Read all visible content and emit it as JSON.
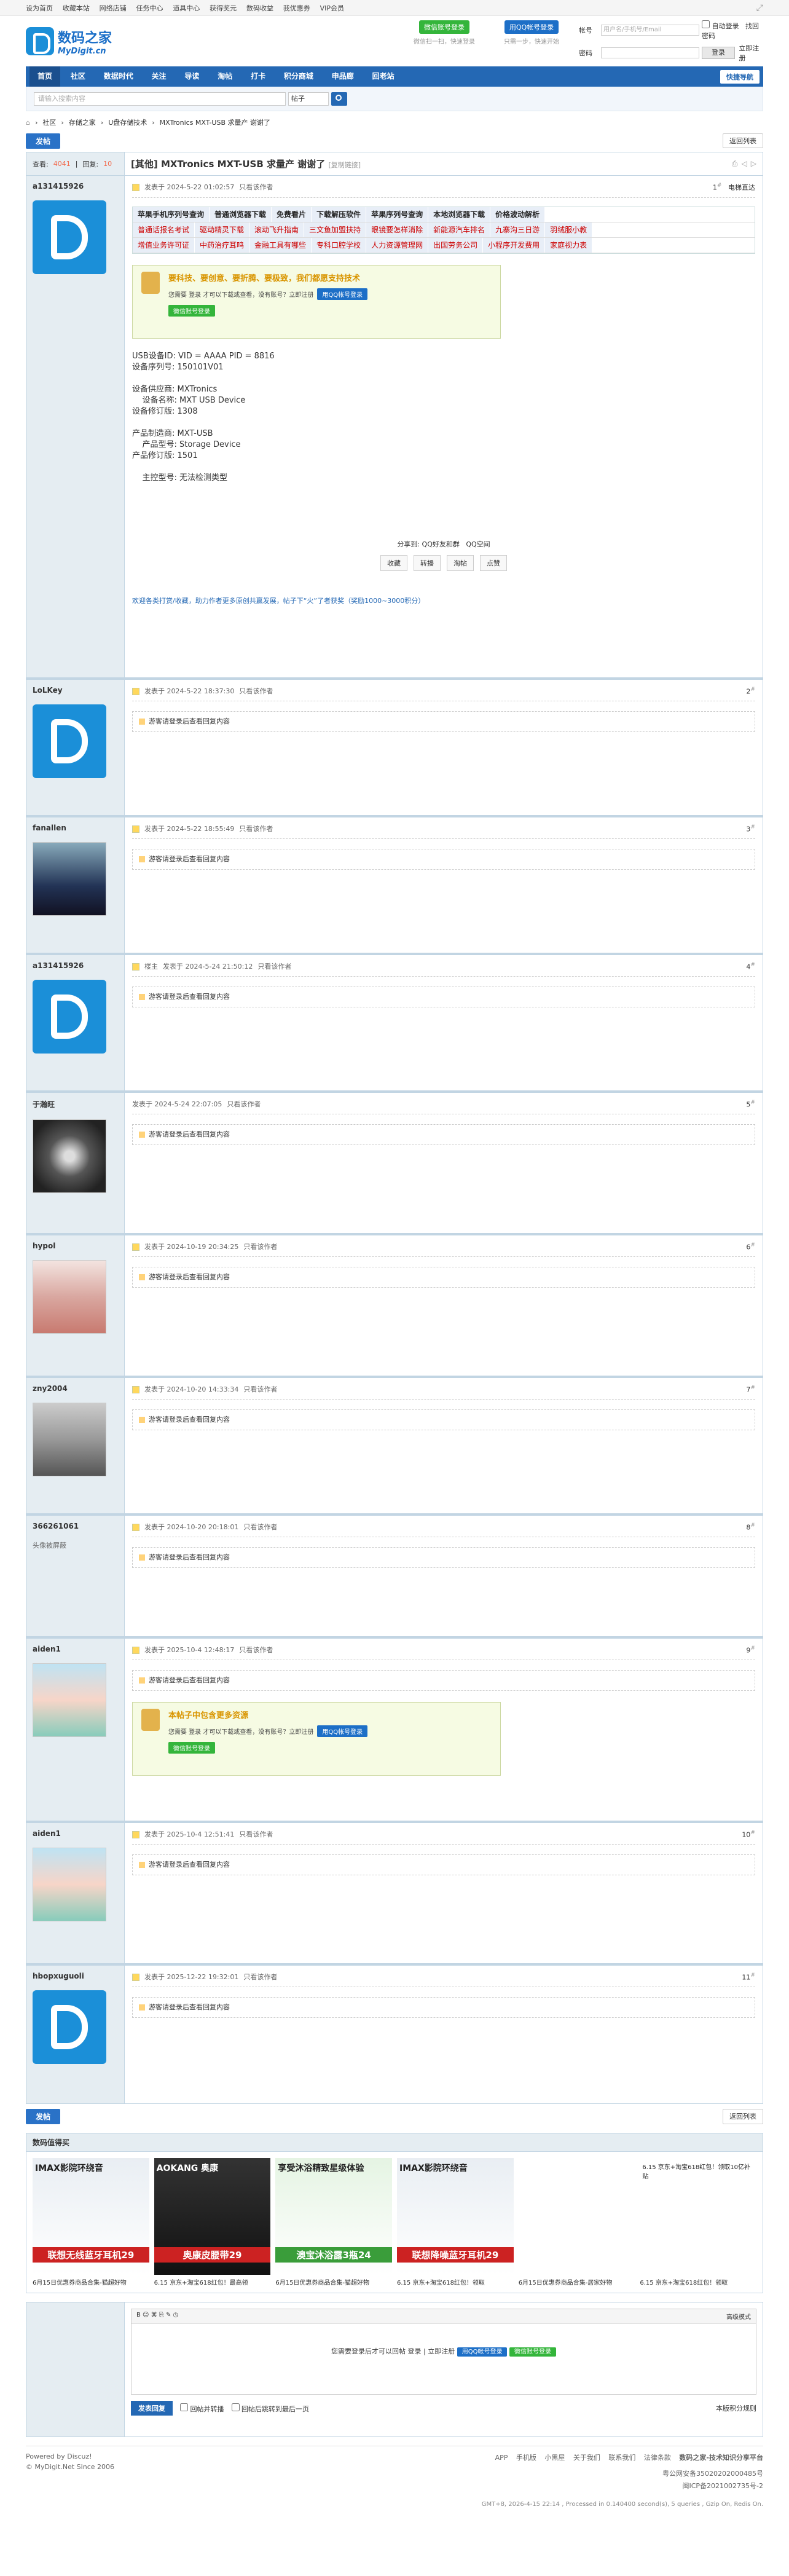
{
  "topbar": {
    "links": [
      "设为首页",
      "收藏本站",
      "网络店铺",
      "任务中心",
      "道具中心",
      "获得奖元",
      "数码收益",
      "我优惠券",
      "VIP会员"
    ]
  },
  "header": {
    "logo_cn": "数码之家",
    "logo_en": "MyDigit.cn",
    "wechat_label": "微信账号登录",
    "wechat_sub": "微信扫一扫，快速登录",
    "qq_label": "用QQ帐号登录",
    "qq_sub": "只需一步，快速开始",
    "account_label": "帐号",
    "account_placeholder": "用户名/手机号/Email",
    "autologin": "自动登录",
    "forgot": "找回密码",
    "password_label": "密码",
    "login_btn": "登录",
    "register": "立即注册"
  },
  "nav": {
    "items": [
      "首页",
      "社区",
      "数据时代",
      "关注",
      "导读",
      "淘帖",
      "打卡",
      "积分商城",
      "申品廊",
      "回老站"
    ],
    "quick": "快捷导航"
  },
  "search": {
    "placeholder": "请输入搜索内容",
    "type": "帖子"
  },
  "breadcrumb": [
    "社区",
    "存储之家",
    "U盘存储技术",
    "MXTronics MXT-USB 求量产 谢谢了"
  ],
  "buttons": {
    "post": "发帖",
    "back": "返回列表"
  },
  "thread": {
    "views_label": "查看:",
    "views": "4041",
    "replies_label": "回复:",
    "replies": "10",
    "tag": "[其他]",
    "title": "MXTronics MXT-USB 求量产 谢谢了",
    "copy_link": "[复制链接]",
    "goto_label": "电梯直达"
  },
  "ads": {
    "row1": [
      "苹果手机序列号查询",
      "普通浏览器下载",
      "免费看片",
      "下载解压软件",
      "苹果序列号查询",
      "本地浏览器下载",
      "价格波动解析"
    ],
    "row2": [
      "普通话报名考试",
      "驱动精灵下载",
      "滚动飞升指南",
      "三文鱼加盟扶持",
      "眼镜要怎样消除",
      "新能源汽车排名",
      "九寨沟三日游",
      "羽绒服小教"
    ],
    "row3": [
      "增值业务许可证",
      "中药治疗耳鸣",
      "金融工具有哪些",
      "专科口腔学校",
      "人力资源管理网",
      "出国劳务公司",
      "小程序开发费用",
      "家庭视力表"
    ]
  },
  "vip": {
    "headline": "要科技、要创意、要折腾、要极致，我们都愿支持技术",
    "line": "您需要 登录 才可以下载或查看，没有账号？立即注册",
    "hidden_headline": "本帖子中包含更多资源"
  },
  "content_lines": [
    "USB设备ID: VID = AAAA PID = 8816",
    "设备序列号: 150101V01",
    "",
    "设备供应商: MXTronics",
    "    设备名称: MXT USB Device",
    "设备修订版: 1308",
    "",
    "产品制造商: MXT-USB",
    "    产品型号: Storage Device",
    "产品修订版: 1501",
    "",
    "    主控型号: 无法检测类型"
  ],
  "share": {
    "label": "分享到:",
    "qqfriend": "QQ好友和群",
    "qqzone": "QQ空间"
  },
  "actions": [
    "收藏",
    "转播",
    "淘帖",
    "点赞"
  ],
  "notice": "欢迎各类打赏/收藏，助力作者更多原创共赢发展，帖子下“火”了者获奖（奖励1000~3000积分）",
  "lock_text": "游客请登录后查看回复内容",
  "posts": [
    {
      "user": "a131415926",
      "time": "发表于 2024-5-22 01:02:57",
      "only": "只看该作者",
      "floor": "1",
      "avatar": "logo"
    },
    {
      "user": "LoLKey",
      "time": "发表于 2024-5-22 18:37:30",
      "only": "只看该作者",
      "floor": "2",
      "avatar": "logo"
    },
    {
      "user": "fanallen",
      "time": "发表于 2024-5-22 18:55:49",
      "only": "只看该作者",
      "floor": "3",
      "avatar": "photo"
    },
    {
      "user": "a131415926",
      "time": "发表于 2024-5-24 21:50:12",
      "only": "只看该作者",
      "floor": "4",
      "avatar": "logo",
      "badge": "楼主"
    },
    {
      "user": "于瀚旺",
      "time": "发表于 2024-5-24 22:07:05",
      "only": "只看该作者",
      "floor": "5",
      "avatar": "photo"
    },
    {
      "user": "hypol",
      "time": "发表于 2024-10-19 20:34:25",
      "only": "只看该作者",
      "floor": "6",
      "avatar": "photo"
    },
    {
      "user": "zny2004",
      "time": "发表于 2024-10-20 14:33:34",
      "only": "只看该作者",
      "floor": "7",
      "avatar": "photo"
    },
    {
      "user": "366261061",
      "time": "发表于 2024-10-20 20:18:01",
      "only": "只看该作者",
      "floor": "8",
      "avatar": "none",
      "subtitle": "头像被屏蔽"
    },
    {
      "user": "aiden1",
      "time": "发表于 2025-10-4 12:48:17",
      "only": "只看该作者",
      "floor": "9",
      "avatar": "photo"
    },
    {
      "user": "aiden1",
      "time": "发表于 2025-10-4 12:51:41",
      "only": "只看该作者",
      "floor": "10",
      "avatar": "photo"
    },
    {
      "user": "hbopxuguoli",
      "time": "发表于 2025-12-22 19:32:01",
      "only": "只看该作者",
      "floor": "11",
      "avatar": "logo"
    }
  ],
  "recommend": {
    "title": "数码值得买",
    "items": [
      {
        "top": "IMAX影院环绕音",
        "cap": "联想无线蓝牙耳机29",
        "desc": "6月15日优惠券商品合集-猫超好物"
      },
      {
        "top": "AOKANG 奥康",
        "cap": "奥康皮腰带29",
        "desc": "6.15 京东+淘宝618红包！最高领"
      },
      {
        "top": "享受沐浴精致星级体验",
        "cap": "澳宝沐浴露3瓶24",
        "desc": "6月15日优惠券商品合集-猫超好物"
      },
      {
        "top": "IMAX影院环绕音",
        "cap": "联想降噪蓝牙耳机29",
        "desc": "6.15 京东+淘宝618红包！领取"
      },
      {
        "top": "",
        "cap": "",
        "desc": "6月15日优惠券商品合集-居家好物"
      },
      {
        "top": "6.15 京东+淘宝618红包！领取10亿补贴",
        "cap": "",
        "desc": "6.15 京东+淘宝618红包！领取"
      }
    ]
  },
  "reply": {
    "advanced": "高级模式",
    "msg": "您需要登录后才可以回帖 登录 | 立即注册",
    "send": "发表回复",
    "opt1": "回帖并转播",
    "opt2": "回帖后跳转到最后一页",
    "rule": "本版积分规则"
  },
  "footer": {
    "powered": "Powered by Discuz!",
    "copy": "© MyDigit.Net Since 2006",
    "links": [
      "APP",
      "手机版",
      "小黑屋",
      "关于我们",
      "联系我们",
      "法律条款",
      "数码之家-技术知识分享平台"
    ],
    "icp1": "粤公网安备35020202000485号",
    "icp2": "闽ICP备2021002735号-2",
    "stats": "GMT+8, 2026-4-15 22:14 , Processed in 0.140400 second(s), 5 queries , Gzip On, Redis On."
  }
}
